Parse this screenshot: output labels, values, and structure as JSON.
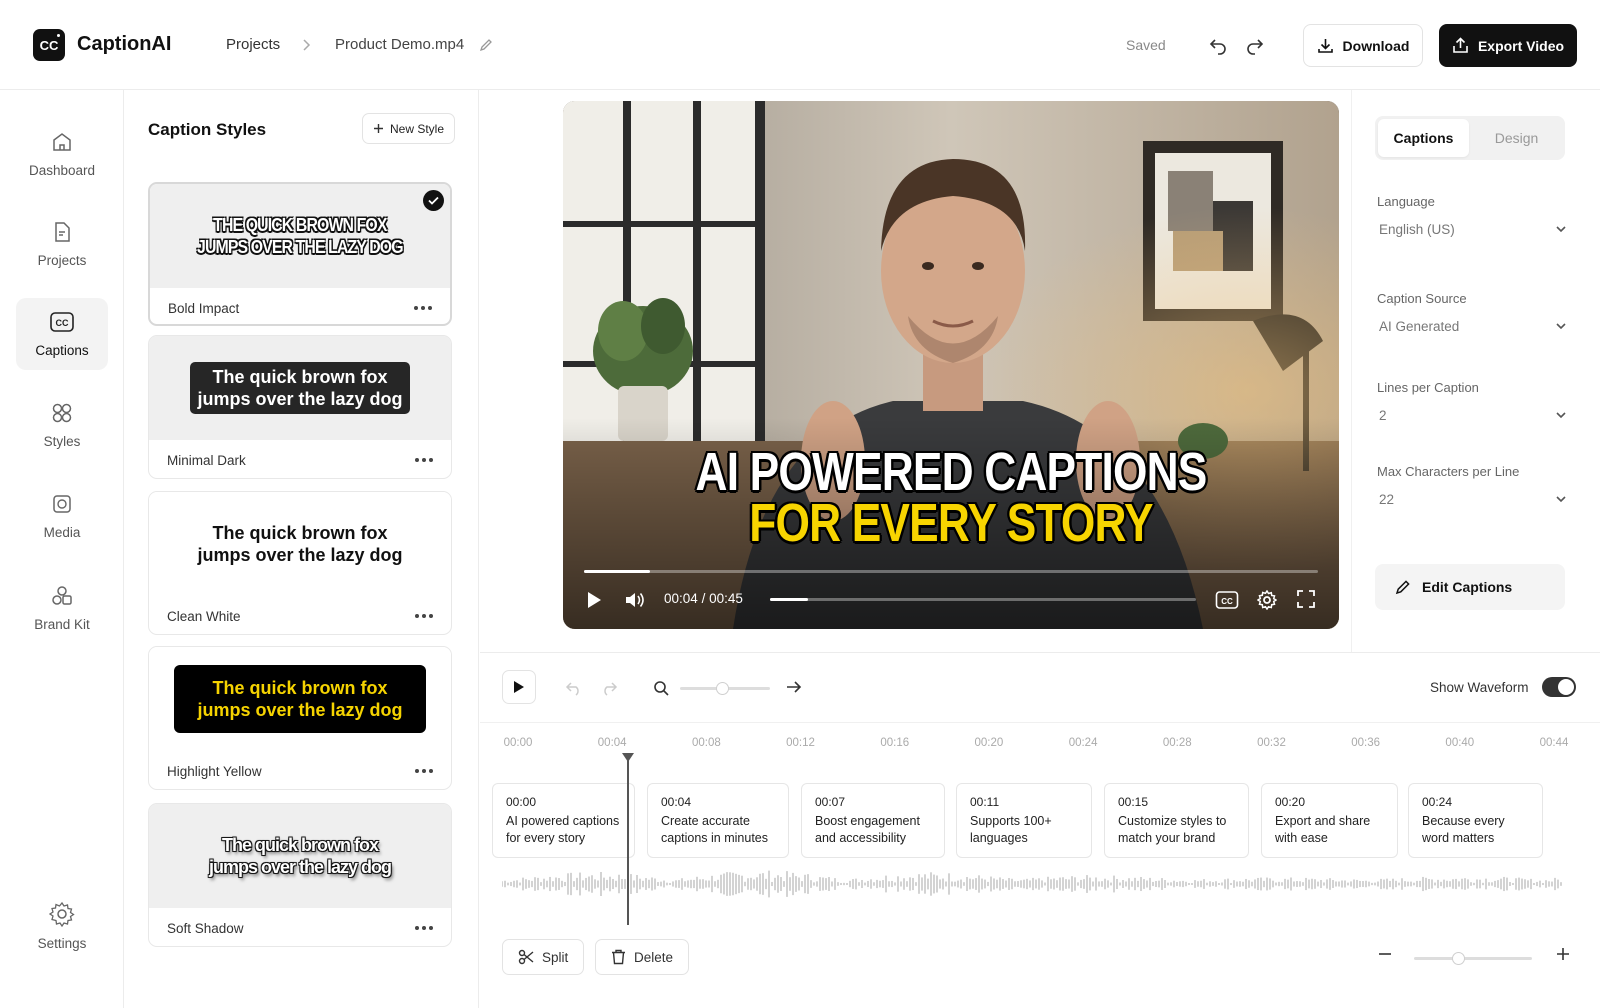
{
  "app": {
    "logo_text": "CC",
    "name": "CaptionAI"
  },
  "breadcrumb": {
    "projects": "Projects",
    "file": "Product Demo.mp4"
  },
  "header": {
    "saved": "Saved",
    "download": "Download",
    "export": "Export Video"
  },
  "nav": [
    {
      "label": "Dashboard",
      "icon": "home-icon"
    },
    {
      "label": "Projects",
      "icon": "file-icon"
    },
    {
      "label": "Captions",
      "icon": "cc-icon",
      "active": true
    },
    {
      "label": "Styles",
      "icon": "styles-icon"
    },
    {
      "label": "Media",
      "icon": "media-icon"
    },
    {
      "label": "Brand Kit",
      "icon": "shapes-icon"
    },
    {
      "label": "Settings",
      "icon": "gear-icon"
    }
  ],
  "styles_panel": {
    "title": "Caption Styles",
    "new_style": "New Style",
    "cards": [
      {
        "name": "Bold Impact",
        "preview": "THE QUICK BROWN FOX\nJUMPS OVER THE LAZY DOG",
        "selected": true
      },
      {
        "name": "Minimal Dark",
        "preview": "The quick brown fox\njumps over the lazy dog"
      },
      {
        "name": "Clean White",
        "preview": "The quick brown fox\njumps over the lazy dog"
      },
      {
        "name": "Highlight Yellow",
        "preview": "The quick brown fox\njumps over the lazy dog"
      },
      {
        "name": "Soft Shadow",
        "preview": "The quick brown fox\njumps over the lazy dog"
      }
    ]
  },
  "video": {
    "caption_line1": "AI POWERED CAPTIONS",
    "caption_line2": "FOR EVERY STORY",
    "current": "00:04",
    "separator": "/",
    "total": "00:45",
    "progress": 0.09,
    "highlight_color": "#f7d400"
  },
  "right_panel": {
    "tabs": [
      "Captions",
      "Design"
    ],
    "fields": [
      {
        "label": "Language",
        "value": "English (US)"
      },
      {
        "label": "Caption Source",
        "value": "AI Generated"
      },
      {
        "label": "Lines per Caption",
        "value": "2"
      },
      {
        "label": "Max Characters per Line",
        "value": "22"
      }
    ],
    "edit_captions": "Edit Captions"
  },
  "timeline": {
    "show_waveform": "Show Waveform",
    "waveform_on": true,
    "ticks": [
      "00:00",
      "00:04",
      "00:08",
      "00:12",
      "00:16",
      "00:20",
      "00:24",
      "00:28",
      "00:32",
      "00:36",
      "00:40",
      "00:44"
    ],
    "playhead_time": "00:04",
    "clips": [
      {
        "time": "00:00",
        "text": "AI powered captions for every story"
      },
      {
        "time": "00:04",
        "text": "Create accurate captions in minutes"
      },
      {
        "time": "00:07",
        "text": "Boost engagement and accessibility"
      },
      {
        "time": "00:11",
        "text": "Supports 100+ languages"
      },
      {
        "time": "00:15",
        "text": "Customize styles to match your brand"
      },
      {
        "time": "00:20",
        "text": "Export and share with ease"
      },
      {
        "time": "00:24",
        "text": "Because every word matters"
      }
    ],
    "split": "Split",
    "delete": "Delete"
  }
}
